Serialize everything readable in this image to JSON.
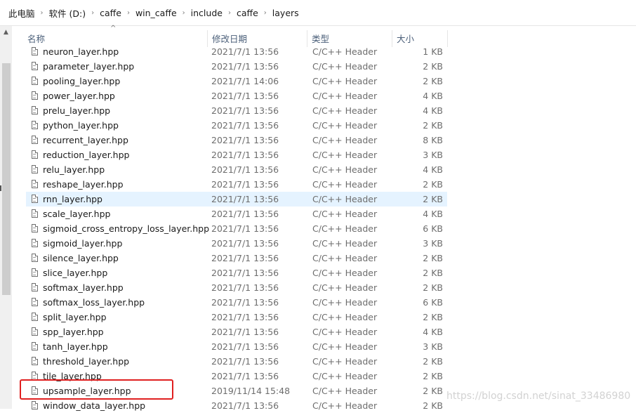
{
  "breadcrumb": [
    "此电脑",
    "软件 (D:)",
    "caffe",
    "win_caffe",
    "include",
    "caffe",
    "layers"
  ],
  "columns": {
    "name": "名称",
    "date": "修改日期",
    "type": "类型",
    "size": "大小"
  },
  "files": [
    {
      "name": "neuron_layer.hpp",
      "date": "2021/7/1 13:56",
      "type": "C/C++ Header",
      "size": "1 KB"
    },
    {
      "name": "parameter_layer.hpp",
      "date": "2021/7/1 13:56",
      "type": "C/C++ Header",
      "size": "2 KB"
    },
    {
      "name": "pooling_layer.hpp",
      "date": "2021/7/1 14:06",
      "type": "C/C++ Header",
      "size": "2 KB"
    },
    {
      "name": "power_layer.hpp",
      "date": "2021/7/1 13:56",
      "type": "C/C++ Header",
      "size": "4 KB"
    },
    {
      "name": "prelu_layer.hpp",
      "date": "2021/7/1 13:56",
      "type": "C/C++ Header",
      "size": "4 KB"
    },
    {
      "name": "python_layer.hpp",
      "date": "2021/7/1 13:56",
      "type": "C/C++ Header",
      "size": "2 KB"
    },
    {
      "name": "recurrent_layer.hpp",
      "date": "2021/7/1 13:56",
      "type": "C/C++ Header",
      "size": "8 KB"
    },
    {
      "name": "reduction_layer.hpp",
      "date": "2021/7/1 13:56",
      "type": "C/C++ Header",
      "size": "3 KB"
    },
    {
      "name": "relu_layer.hpp",
      "date": "2021/7/1 13:56",
      "type": "C/C++ Header",
      "size": "4 KB"
    },
    {
      "name": "reshape_layer.hpp",
      "date": "2021/7/1 13:56",
      "type": "C/C++ Header",
      "size": "2 KB"
    },
    {
      "name": "rnn_layer.hpp",
      "date": "2021/7/1 13:56",
      "type": "C/C++ Header",
      "size": "2 KB",
      "selected": true
    },
    {
      "name": "scale_layer.hpp",
      "date": "2021/7/1 13:56",
      "type": "C/C++ Header",
      "size": "4 KB"
    },
    {
      "name": "sigmoid_cross_entropy_loss_layer.hpp",
      "date": "2021/7/1 13:56",
      "type": "C/C++ Header",
      "size": "6 KB"
    },
    {
      "name": "sigmoid_layer.hpp",
      "date": "2021/7/1 13:56",
      "type": "C/C++ Header",
      "size": "3 KB"
    },
    {
      "name": "silence_layer.hpp",
      "date": "2021/7/1 13:56",
      "type": "C/C++ Header",
      "size": "2 KB"
    },
    {
      "name": "slice_layer.hpp",
      "date": "2021/7/1 13:56",
      "type": "C/C++ Header",
      "size": "2 KB"
    },
    {
      "name": "softmax_layer.hpp",
      "date": "2021/7/1 13:56",
      "type": "C/C++ Header",
      "size": "2 KB"
    },
    {
      "name": "softmax_loss_layer.hpp",
      "date": "2021/7/1 13:56",
      "type": "C/C++ Header",
      "size": "6 KB"
    },
    {
      "name": "split_layer.hpp",
      "date": "2021/7/1 13:56",
      "type": "C/C++ Header",
      "size": "2 KB"
    },
    {
      "name": "spp_layer.hpp",
      "date": "2021/7/1 13:56",
      "type": "C/C++ Header",
      "size": "4 KB"
    },
    {
      "name": "tanh_layer.hpp",
      "date": "2021/7/1 13:56",
      "type": "C/C++ Header",
      "size": "3 KB"
    },
    {
      "name": "threshold_layer.hpp",
      "date": "2021/7/1 13:56",
      "type": "C/C++ Header",
      "size": "2 KB"
    },
    {
      "name": "tile_layer.hpp",
      "date": "2021/7/1 13:56",
      "type": "C/C++ Header",
      "size": "2 KB"
    },
    {
      "name": "upsample_layer.hpp",
      "date": "2019/11/14 15:48",
      "type": "C/C++ Header",
      "size": "2 KB"
    },
    {
      "name": "window_data_layer.hpp",
      "date": "2021/7/1 13:56",
      "type": "C/C++ Header",
      "size": "2 KB"
    }
  ],
  "watermark": "https://blog.csdn.net/sinat_33486980",
  "colors": {
    "selected_row": "#e5f3ff",
    "highlight_box": "#e02020",
    "header_text": "#4c607a"
  }
}
